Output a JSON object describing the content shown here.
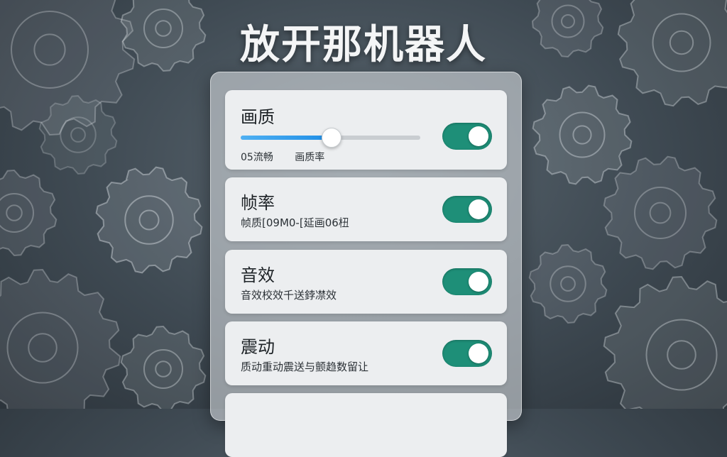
{
  "title": "放开那机器人",
  "background": {
    "theme": "gears",
    "color": "#3f4a53"
  },
  "settings": [
    {
      "title": "画质",
      "slider": {
        "value": 0.5,
        "labels": [
          "05流畅",
          "画质率"
        ]
      },
      "toggle_on": true
    },
    {
      "title": "帧率",
      "subtitle": "帧质[09M0-[延画06杻",
      "toggle_on": true
    },
    {
      "title": "音效",
      "subtitle": "音效校效千送鋍凚效",
      "toggle_on": true
    },
    {
      "title": "震动",
      "subtitle": "质动重动震送与颤趋数留让",
      "toggle_on": true
    }
  ],
  "colors": {
    "toggle_on": "#1e8f78",
    "slider_fill": "#1f8ee6",
    "card_bg": "#eceef0"
  }
}
